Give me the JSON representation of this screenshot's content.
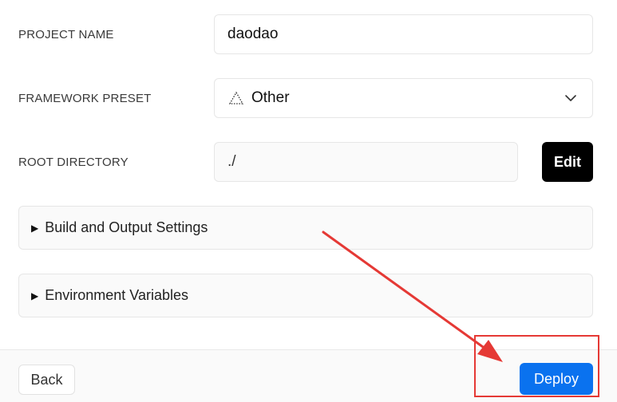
{
  "form": {
    "project_name": {
      "label": "PROJECT NAME",
      "value": "daodao"
    },
    "framework_preset": {
      "label": "FRAMEWORK PRESET",
      "value": "Other",
      "icon": "triangle-dotted-icon"
    },
    "root_directory": {
      "label": "ROOT DIRECTORY",
      "value": "./",
      "edit_label": "Edit"
    }
  },
  "sections": {
    "build_output": "Build and Output Settings",
    "environment_variables": "Environment Variables"
  },
  "footer": {
    "back_label": "Back",
    "deploy_label": "Deploy"
  },
  "annotation": {
    "color": "#e53935"
  },
  "colors": {
    "deploy_button": "#0a72ef",
    "edit_button": "#000000"
  }
}
